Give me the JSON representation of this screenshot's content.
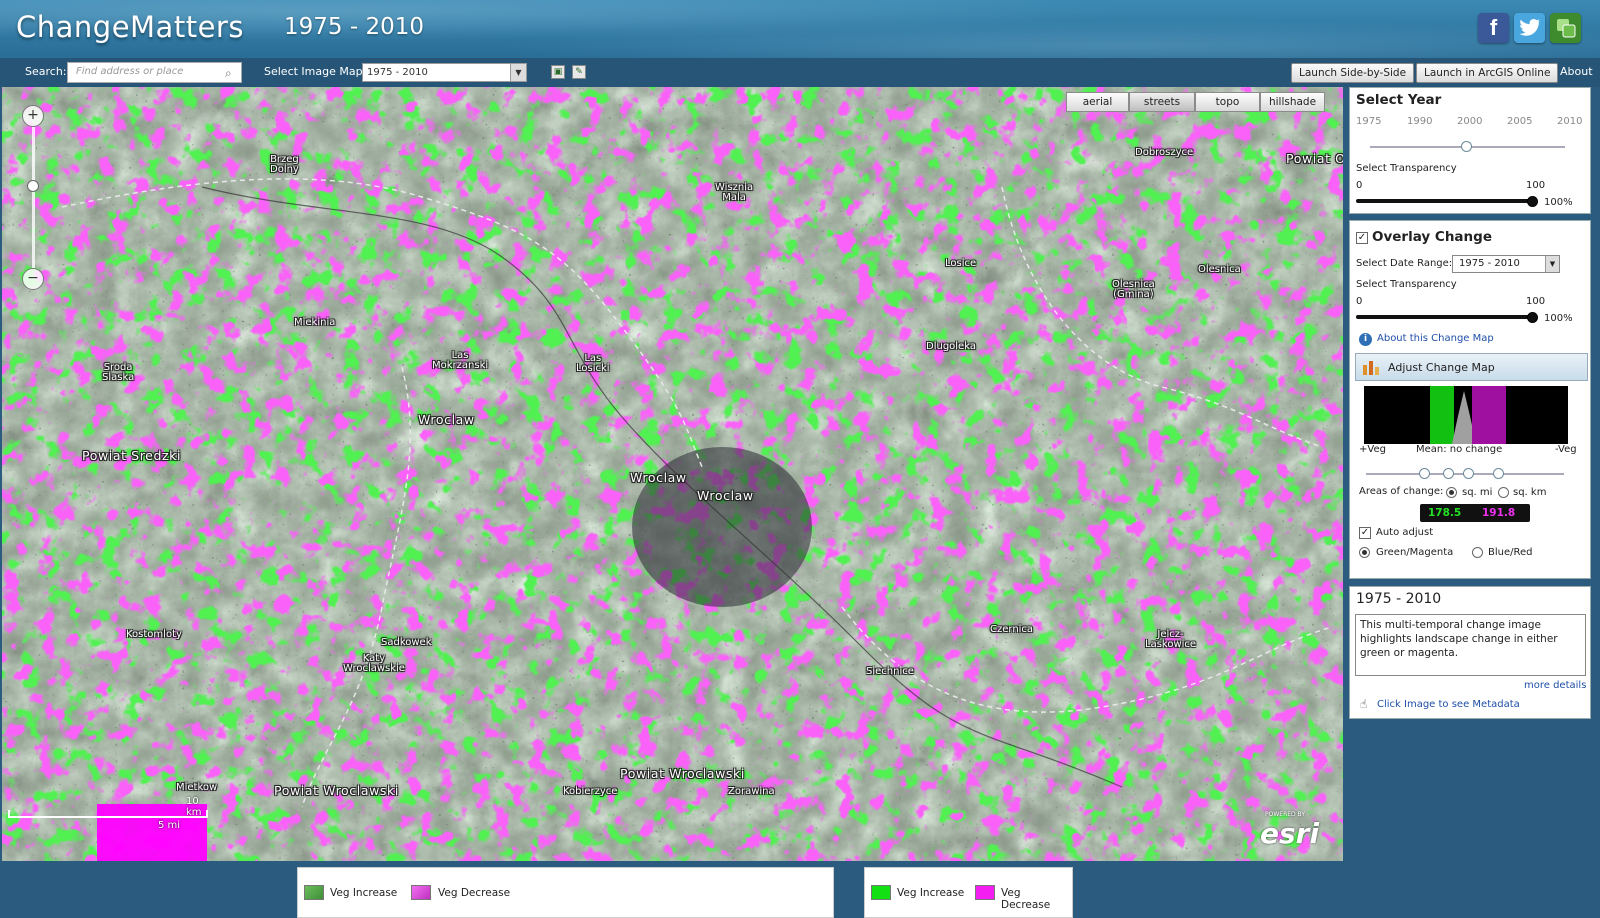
{
  "header": {
    "app_title": "ChangeMatters",
    "date_range": "1975 - 2010",
    "social": {
      "facebook": "f",
      "twitter": "t",
      "share": "share-icon"
    }
  },
  "toolbar": {
    "search_label": "Search:",
    "search_placeholder": "Find address or place",
    "image_map_label": "Select Image Map:",
    "image_map_value": "1975 - 2010",
    "launch_side_by_side": "Launch Side-by-Side",
    "launch_arcgis": "Launch in ArcGIS Online",
    "about": "About"
  },
  "map": {
    "basemaps": [
      "aerial",
      "streets",
      "topo",
      "hillshade"
    ],
    "places": [
      {
        "name": "Brzeg\nDolny",
        "big": false
      },
      {
        "name": "Wisznia\nMala",
        "big": false
      },
      {
        "name": "Dobroszyce",
        "big": false
      },
      {
        "name": "Powiat O",
        "big": true
      },
      {
        "name": "Olesnica",
        "big": false
      },
      {
        "name": "Olesnica\n(Gmina)",
        "big": false
      },
      {
        "name": "Losice",
        "big": false
      },
      {
        "name": "Miekinia",
        "big": false
      },
      {
        "name": "Las\nMokrzanski",
        "big": false
      },
      {
        "name": "Las\nLosicki",
        "big": false
      },
      {
        "name": "Dlugoleka",
        "big": false
      },
      {
        "name": "Sroda\nSlaska",
        "big": false
      },
      {
        "name": "Wroclaw",
        "big": true
      },
      {
        "name": "Powiat Sredzki",
        "big": true
      },
      {
        "name": "Wroclaw",
        "big": true
      },
      {
        "name": "Wroclaw",
        "big": true
      },
      {
        "name": "Kostomloty",
        "big": false
      },
      {
        "name": "Sadkowek",
        "big": false
      },
      {
        "name": "Katy\nWroclawskie",
        "big": false
      },
      {
        "name": "Czernica",
        "big": false
      },
      {
        "name": "Jelcz-\nLaskowice",
        "big": false
      },
      {
        "name": "Siechnice",
        "big": false
      },
      {
        "name": "Powiat Wroclawski",
        "big": true
      },
      {
        "name": "Powiat Wroclawski",
        "big": true
      },
      {
        "name": "Kobierzyce",
        "big": false
      },
      {
        "name": "Zorawina",
        "big": false
      },
      {
        "name": "Mietkow",
        "big": false
      }
    ],
    "scale_km": "10 km",
    "scale_mi": "5 mi",
    "esri_powered": "POWERED BY",
    "esri": "esri"
  },
  "year_panel": {
    "title": "Select Year",
    "years": [
      "1975",
      "1990",
      "2000",
      "2005",
      "2010"
    ],
    "selected_year": "2000",
    "transparency_label": "Select Transparency",
    "min": "0",
    "max": "100",
    "value": "100%"
  },
  "overlay_panel": {
    "title": "Overlay Change",
    "checked": true,
    "date_range_label": "Select Date Range:",
    "date_range_value": "1975 - 2010",
    "transparency_label": "Select Transparency",
    "min": "0",
    "max": "100",
    "value": "100%",
    "about_link": "About this Change Map",
    "adjust_label": "Adjust Change Map",
    "hist_left": "+Veg",
    "hist_mid": "Mean: no change",
    "hist_right": "-Veg",
    "areas_label": "Areas of change:",
    "unit_mi": "sq. mi",
    "unit_km": "sq. km",
    "selected_unit": "sq. mi",
    "veg_increase_value": "178.5",
    "veg_decrease_value": "191.8",
    "auto_adjust": "Auto adjust",
    "auto_adjust_checked": true,
    "scheme_green_magenta": "Green/Magenta",
    "scheme_blue_red": "Blue/Red",
    "selected_scheme": "Green/Magenta"
  },
  "info_panel": {
    "title": "1975 - 2010",
    "description": "This multi-temporal change image highlights landscape change in either green or magenta.",
    "more_details": "more details",
    "metadata_hint": "Click Image to see Metadata"
  },
  "legend": {
    "left": {
      "increase": "Veg Increase",
      "decrease": "Veg Decrease"
    },
    "right": {
      "increase": "Veg Increase",
      "decrease": "Veg Decrease"
    }
  },
  "colors": {
    "veg_increase": "#12e012",
    "veg_decrease": "#f21ef2",
    "header_blue": "#3283b0",
    "toolbar_blue": "#275577"
  }
}
